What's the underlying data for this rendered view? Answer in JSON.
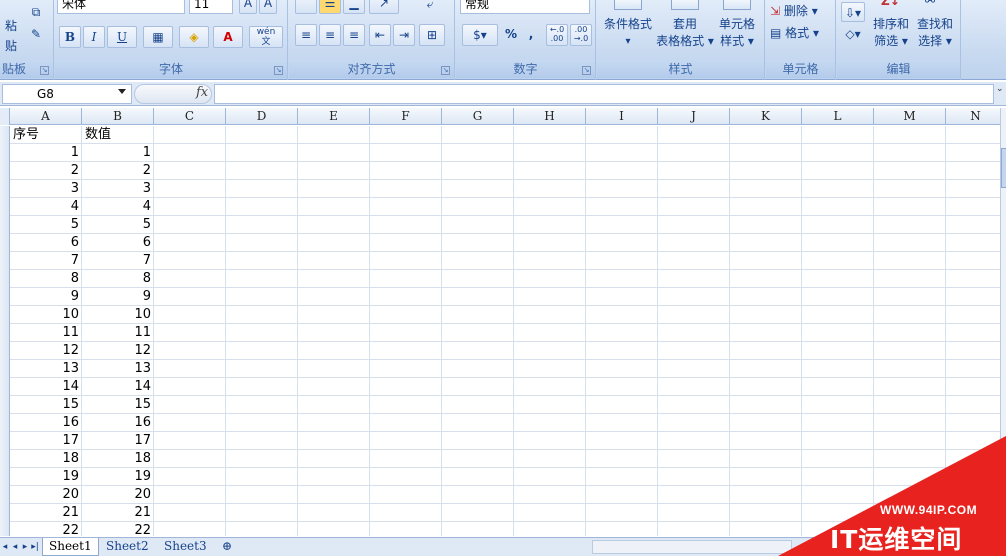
{
  "ribbon": {
    "clipboard": {
      "paste_label": "粘贴",
      "group_label": "贴板"
    },
    "font": {
      "font_name": "宋体",
      "font_size": "11",
      "bold": "B",
      "italic": "I",
      "underline": "U",
      "font_color_glyph": "A",
      "phonetic": "wén\n文",
      "group_label": "字体"
    },
    "alignment": {
      "group_label": "对齐方式"
    },
    "number": {
      "format": "常规",
      "percent": "%",
      "comma": ",",
      "inc_decimal": "←.0\n.00",
      "dec_decimal": ".00\n→.0",
      "group_label": "数字"
    },
    "styles": {
      "conditional_line1": "条件格式",
      "conditional_line2": "▾",
      "table_line1": "套用",
      "table_line2": "表格格式 ▾",
      "cell_line1": "单元格",
      "cell_line2": "样式 ▾",
      "group_label": "样式"
    },
    "cells": {
      "delete": "删除 ▾",
      "format": "格式 ▾",
      "group_label": "单元格"
    },
    "editing": {
      "sort_line1": "排序和",
      "sort_line2": "筛选 ▾",
      "find_line1": "查找和",
      "find_line2": "选择 ▾",
      "group_label": "编辑"
    }
  },
  "formula_bar": {
    "name_box": "G8",
    "fx": "fx",
    "formula": ""
  },
  "grid": {
    "columns": [
      "A",
      "B",
      "C",
      "D",
      "E",
      "F",
      "G",
      "H",
      "I",
      "J",
      "K",
      "L",
      "M",
      "N"
    ],
    "headers": [
      "序号",
      "数值"
    ],
    "rows": [
      [
        "1",
        "1"
      ],
      [
        "2",
        "2"
      ],
      [
        "3",
        "3"
      ],
      [
        "4",
        "4"
      ],
      [
        "5",
        "5"
      ],
      [
        "6",
        "6"
      ],
      [
        "7",
        "7"
      ],
      [
        "8",
        "8"
      ],
      [
        "9",
        "9"
      ],
      [
        "10",
        "10"
      ],
      [
        "11",
        "11"
      ],
      [
        "12",
        "12"
      ],
      [
        "13",
        "13"
      ],
      [
        "14",
        "14"
      ],
      [
        "15",
        "15"
      ],
      [
        "16",
        "16"
      ],
      [
        "17",
        "17"
      ],
      [
        "18",
        "18"
      ],
      [
        "19",
        "19"
      ],
      [
        "20",
        "20"
      ],
      [
        "21",
        "21"
      ],
      [
        "22",
        "22"
      ]
    ]
  },
  "sheets": {
    "tabs": [
      "Sheet1",
      "Sheet2",
      "Sheet3"
    ],
    "active": 0
  },
  "watermark": {
    "url": "WWW.94IP.COM",
    "text": "IT运维空间",
    "color": "#e8231f"
  }
}
